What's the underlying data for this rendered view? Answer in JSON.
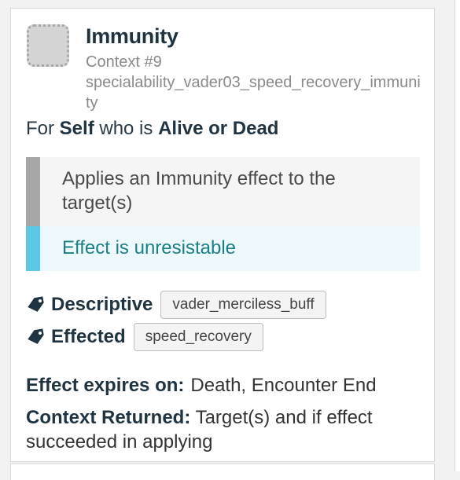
{
  "ability": {
    "title": "Immunity",
    "context": "Context #9",
    "context_id": "specialability_vader03_speed_recovery_immunity"
  },
  "target": {
    "prefix": "For",
    "who": "Self",
    "middle": "who is",
    "state": "Alive or Dead"
  },
  "description": {
    "main": "Applies an Immunity effect to the target(s)",
    "note": "Effect is unresistable"
  },
  "tags": [
    {
      "label": "Descriptive",
      "value": "vader_merciless_buff"
    },
    {
      "label": "Effected",
      "value": "speed_recovery"
    }
  ],
  "expires": {
    "label": "Effect expires on:",
    "values": "Death, Encounter End"
  },
  "returned": {
    "label": "Context Returned:",
    "value": "Target(s) and if effect succeeded in applying"
  },
  "colors": {
    "title": "#1f3340",
    "note_text": "#1b7f86",
    "note_bar": "#5bc8e8",
    "main_bar": "#a7a7a7"
  }
}
